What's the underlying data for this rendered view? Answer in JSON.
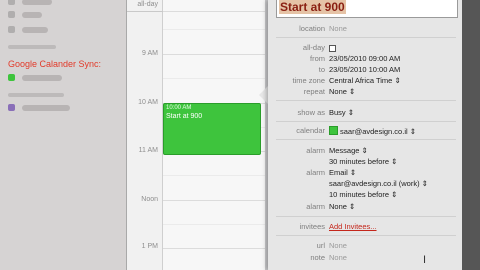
{
  "sidebar": {
    "overlay_caption": "Google Calander Sync:"
  },
  "day_view": {
    "allday_label": "all-day",
    "time_labels": [
      "9 AM",
      "10 AM",
      "11 AM",
      "Noon",
      "1 PM"
    ]
  },
  "event": {
    "time": "10:00 AM",
    "title": "Start at 900",
    "color": "#3ec43d"
  },
  "inspector": {
    "title": "Start at 900",
    "location": {
      "label": "location",
      "value": "None"
    },
    "allday": {
      "label": "all-day",
      "checked": false
    },
    "from": {
      "label": "from",
      "value": "23/05/2010 09:00 AM"
    },
    "to": {
      "label": "to",
      "value": "23/05/2010 10:00 AM"
    },
    "time_zone": {
      "label": "time zone",
      "value": "Central Africa Time"
    },
    "repeat": {
      "label": "repeat",
      "value": "None"
    },
    "show_as": {
      "label": "show as",
      "value": "Busy"
    },
    "calendar": {
      "label": "calendar",
      "value": "saar@avdesign.co.il"
    },
    "alarm1": {
      "label": "alarm",
      "type": "Message",
      "when": "30 minutes before"
    },
    "alarm2": {
      "label": "alarm",
      "type": "Email",
      "address": "saar@avdesign.co.il (work)",
      "when": "10 minutes before"
    },
    "alarm3": {
      "label": "alarm",
      "value": "None"
    },
    "invitees": {
      "label": "invitees",
      "link": "Add Invitees..."
    },
    "url": {
      "label": "url",
      "value": "None"
    },
    "note": {
      "label": "note",
      "value": "None"
    }
  }
}
